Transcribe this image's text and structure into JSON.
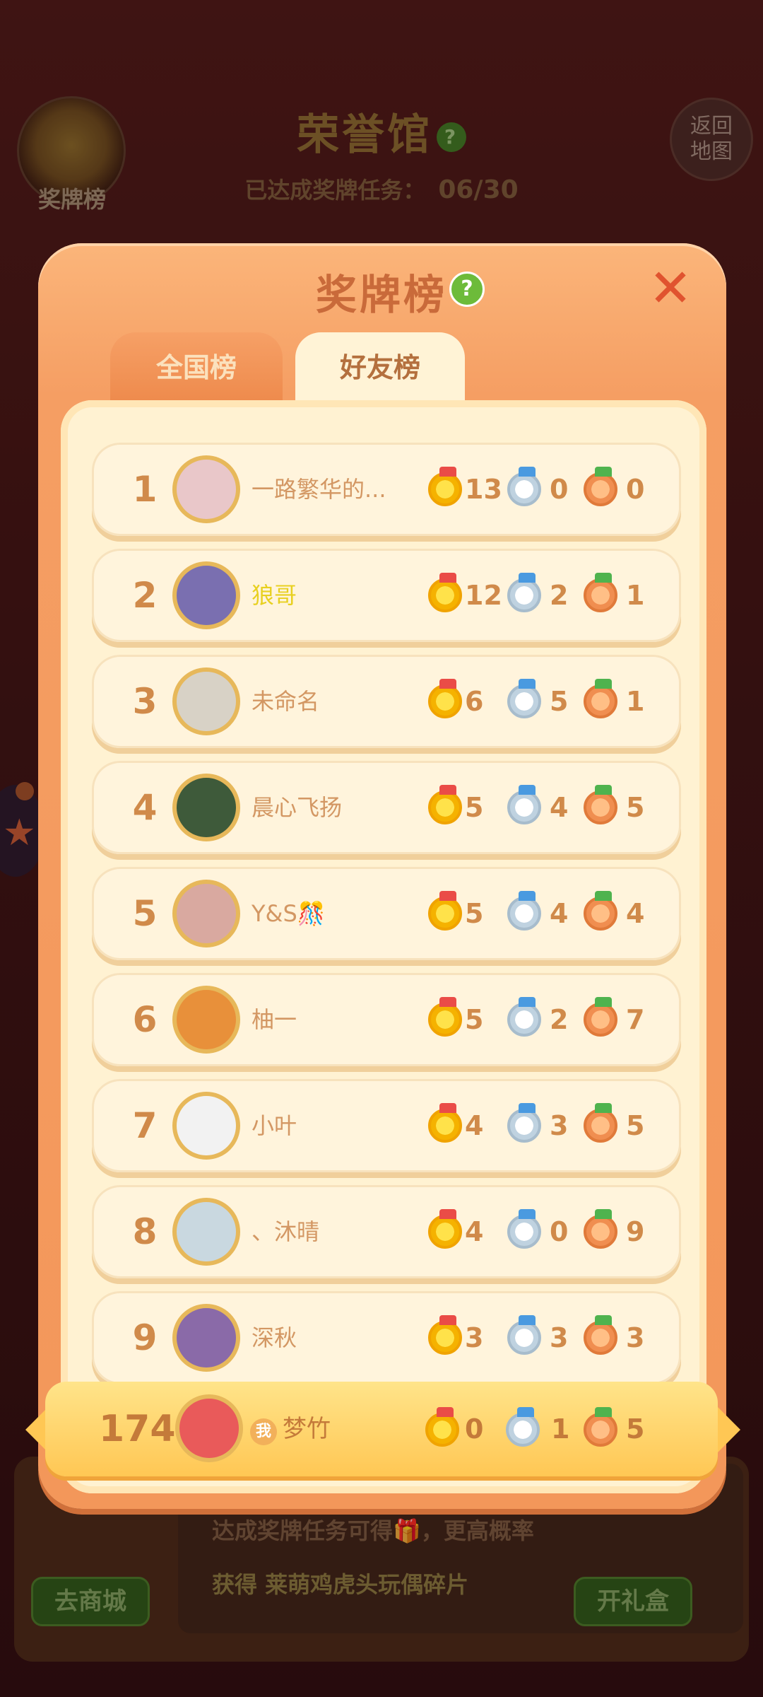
{
  "background": {
    "medal_button_label": "奖牌榜",
    "title": "荣誉馆",
    "achieved_label": "已达成奖牌任务：",
    "achieved_value": "06/30",
    "return_label": "返回地图",
    "bottom_line1": "达成奖牌任务可得",
    "bottom_line1_suffix": "，更高概率",
    "bottom_line2_prefix": "获得",
    "bottom_line2_highlight": "莱萌鸡虎头玩偶碎片",
    "shop_button": "去商城",
    "gift_button": "开礼盒"
  },
  "modal": {
    "title": "奖牌榜",
    "help": "?",
    "close": "✕",
    "tabs": [
      {
        "label": "全国榜",
        "active": false
      },
      {
        "label": "好友榜",
        "active": true
      }
    ]
  },
  "rows": [
    {
      "rank": "1",
      "name": "一路繁华的...",
      "gold": "13",
      "silver": "0",
      "bronze": "0",
      "avatar_color": "#e9c7c9"
    },
    {
      "rank": "2",
      "name": "狼哥",
      "gold": "12",
      "silver": "2",
      "bronze": "1",
      "avatar_color": "#7a6fb0"
    },
    {
      "rank": "3",
      "name": "未命名",
      "gold": "6",
      "silver": "5",
      "bronze": "1",
      "avatar_color": "#d8d2c6"
    },
    {
      "rank": "4",
      "name": "晨心飞扬",
      "gold": "5",
      "silver": "4",
      "bronze": "5",
      "avatar_color": "#3e5a3a"
    },
    {
      "rank": "5",
      "name": "Y&S🎊",
      "gold": "5",
      "silver": "4",
      "bronze": "4",
      "avatar_color": "#d9a9a0"
    },
    {
      "rank": "6",
      "name": "柚一",
      "gold": "5",
      "silver": "2",
      "bronze": "7",
      "avatar_color": "#e8903a"
    },
    {
      "rank": "7",
      "name": "小叶",
      "gold": "4",
      "silver": "3",
      "bronze": "5",
      "avatar_color": "#f2f2f2"
    },
    {
      "rank": "8",
      "name": "、沐晴",
      "gold": "4",
      "silver": "0",
      "bronze": "9",
      "avatar_color": "#c9d8e0"
    },
    {
      "rank": "9",
      "name": "深秋",
      "gold": "3",
      "silver": "3",
      "bronze": "3",
      "avatar_color": "#8a6aa8"
    }
  ],
  "me": {
    "rank": "174",
    "tag": "我",
    "name": "梦竹",
    "gold": "0",
    "silver": "1",
    "bronze": "5",
    "avatar_color": "#e95a5a"
  },
  "colors": {
    "modal": "#f59e63",
    "panel": "#fff2d2",
    "gold": "#f5b200",
    "silver": "#bfd2e0",
    "bronze": "#f08e50",
    "accent": "#d08a4a"
  }
}
